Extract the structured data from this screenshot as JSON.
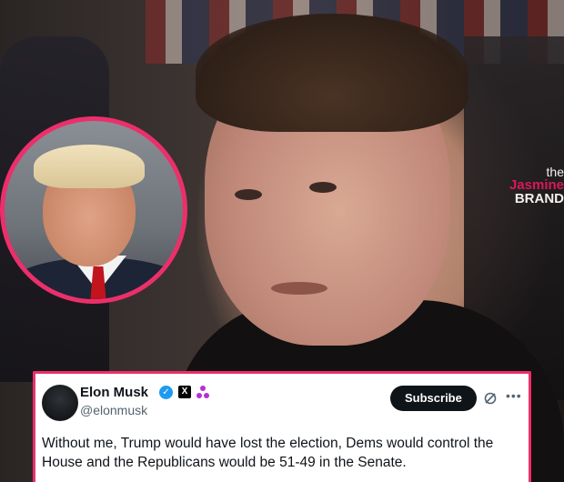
{
  "tweet": {
    "author_name": "Elon Musk",
    "handle": "@elonmusk",
    "subscribe_label": "Subscribe",
    "verified_icon": "verified-check-icon",
    "platform_badge_icon": "x-badge-icon",
    "affiliate_icon": "affiliate-badge-icon",
    "text": "Without me, Trump would have lost the election, Dems would control the House and the Republicans would be 51-49 in the Senate."
  },
  "watermark": {
    "the": "the",
    "jasmine": "Jasmine",
    "brand": "BRAND"
  },
  "colors": {
    "inset_border": "#ec2f6a",
    "verified_blue": "#1d9bf0",
    "watermark_pink": "#d9185c"
  }
}
